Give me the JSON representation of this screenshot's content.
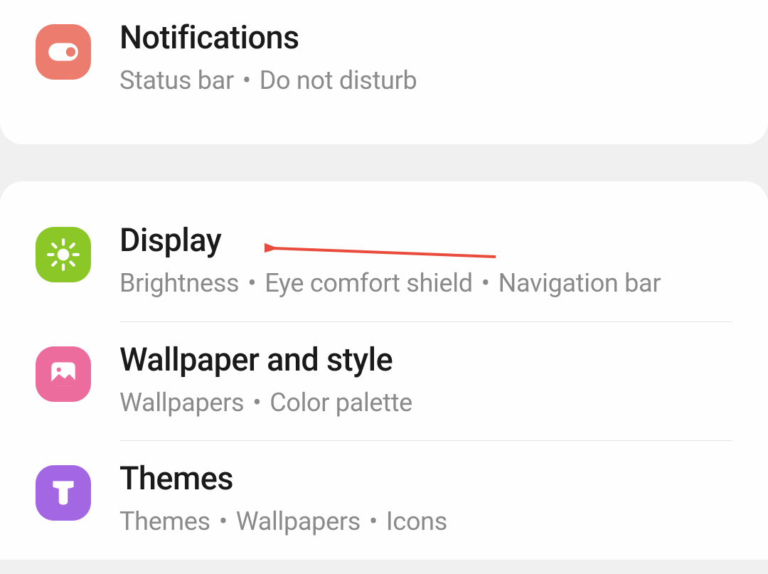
{
  "settings": {
    "notifications": {
      "title": "Notifications",
      "subtitle_parts": [
        "Status bar",
        "Do not disturb"
      ]
    },
    "display": {
      "title": "Display",
      "subtitle_parts": [
        "Brightness",
        "Eye comfort shield",
        "Navigation bar"
      ]
    },
    "wallpaper": {
      "title": "Wallpaper and style",
      "subtitle_parts": [
        "Wallpapers",
        "Color palette"
      ]
    },
    "themes": {
      "title": "Themes",
      "subtitle_parts": [
        "Themes",
        "Wallpapers",
        "Icons"
      ]
    }
  },
  "colors": {
    "notifications_icon": "#ec7d6e",
    "display_icon": "#8bc827",
    "wallpaper_icon": "#ec6c9d",
    "themes_icon": "#a467e3",
    "arrow": "#e94b3c"
  }
}
